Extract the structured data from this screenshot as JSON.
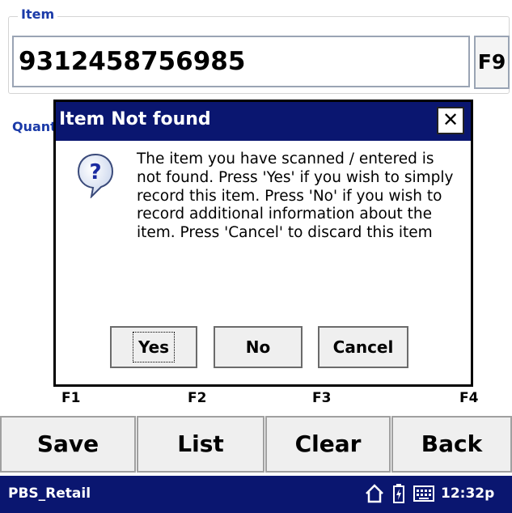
{
  "item_group": {
    "label": "Item",
    "value": "9312458756985",
    "lookup_button": "F9"
  },
  "quantity_label": "Quantity",
  "dialog": {
    "title": "Item Not found",
    "close_glyph": "✕",
    "icon": "question-icon",
    "message": "The item you have scanned / entered is not found. Press 'Yes' if you wish to simply record this item. Press 'No' if you wish to record additional information about the item.  Press 'Cancel' to discard this item",
    "buttons": {
      "yes": "Yes",
      "no": "No",
      "cancel": "Cancel"
    }
  },
  "fkeys": [
    "F1",
    "F2",
    "F3",
    "F4"
  ],
  "soft_buttons": {
    "save": "Save",
    "list": "List",
    "clear": "Clear",
    "back": "Back"
  },
  "taskbar": {
    "app_name": "PBS_Retail",
    "icons": [
      "home-icon",
      "battery-icon",
      "keyboard-icon"
    ],
    "clock": "12:32p"
  },
  "colors": {
    "titlebar": "#0a1670",
    "label_blue": "#1a3aa8",
    "button_face": "#efefef"
  }
}
